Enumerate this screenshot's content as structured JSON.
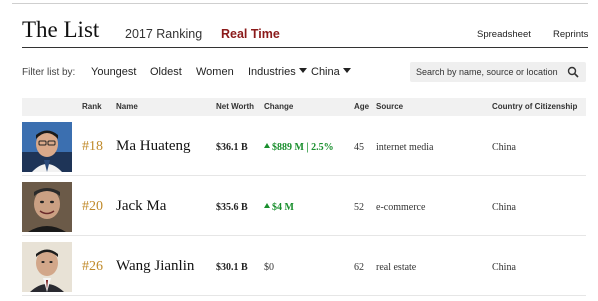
{
  "header": {
    "title": "The List",
    "tabs": [
      {
        "label": "2017 Ranking",
        "active": false
      },
      {
        "label": "Real Time",
        "active": true
      }
    ],
    "links": {
      "spreadsheet": "Spreadsheet",
      "reprints": "Reprints"
    }
  },
  "filters": {
    "label": "Filter list by:",
    "items": [
      "Youngest",
      "Oldest",
      "Women"
    ],
    "industries": "Industries",
    "country": "China",
    "search_placeholder": "Search by name, source or location"
  },
  "table": {
    "columns": {
      "rank": "Rank",
      "name": "Name",
      "net_worth": "Net Worth",
      "change": "Change",
      "age": "Age",
      "source": "Source",
      "country": "Country of Citizenship"
    },
    "rows": [
      {
        "rank": "#18",
        "name": "Ma Huateng",
        "net_worth": "$36.1 B",
        "change": "$889 M | 2.5%",
        "change_direction": "up",
        "age": "45",
        "source": "internet media",
        "country": "China"
      },
      {
        "rank": "#20",
        "name": "Jack Ma",
        "net_worth": "$35.6 B",
        "change": "$4 M",
        "change_direction": "up",
        "age": "52",
        "source": "e-commerce",
        "country": "China"
      },
      {
        "rank": "#26",
        "name": "Wang Jianlin",
        "net_worth": "$30.1 B",
        "change": "$0",
        "change_direction": "none",
        "age": "62",
        "source": "real estate",
        "country": "China"
      }
    ]
  },
  "colors": {
    "accent": "#8b1a1a",
    "rank": "#c08a2a",
    "positive": "#1a8f2e"
  }
}
